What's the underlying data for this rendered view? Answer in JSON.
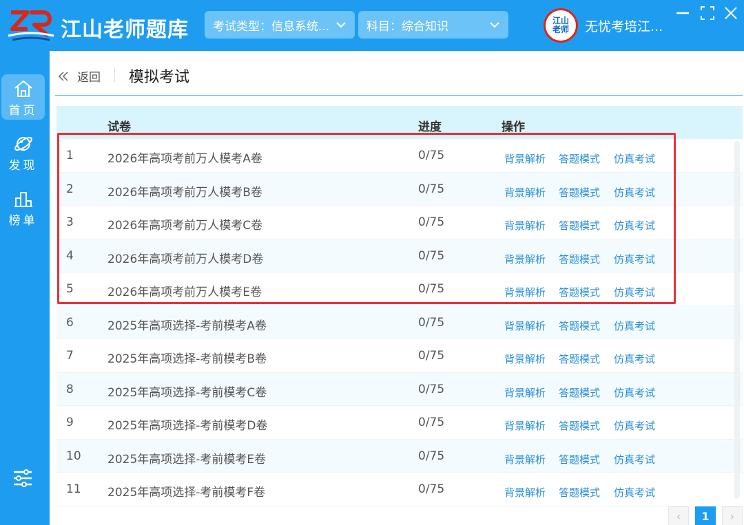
{
  "app": {
    "title": "江山老师题库",
    "logo_text": "ZR"
  },
  "header": {
    "exam_type": "考试类型：信息系统...",
    "subject": "科目：综合知识",
    "avatar_line1": "江山",
    "avatar_line2": "老师",
    "user_name": "无忧考培江..."
  },
  "sidebar": {
    "items": [
      {
        "label": "首页",
        "icon": "home-icon",
        "active": true
      },
      {
        "label": "发现",
        "icon": "planet-icon",
        "active": false
      },
      {
        "label": "榜单",
        "icon": "podium-icon",
        "active": false
      }
    ]
  },
  "main": {
    "back_label": "返回",
    "page_title": "模拟考试",
    "columns": {
      "paper": "试卷",
      "progress": "进度",
      "actions": "操作"
    },
    "action_labels": {
      "analysis": "背景解析",
      "answer": "答题模式",
      "exam": "仿真考试"
    },
    "rows": [
      {
        "idx": "1",
        "name": "2026年高项考前万人模考A卷",
        "progress": "0/75"
      },
      {
        "idx": "2",
        "name": "2026年高项考前万人模考B卷",
        "progress": "0/75"
      },
      {
        "idx": "3",
        "name": "2026年高项考前万人模考C卷",
        "progress": "0/75"
      },
      {
        "idx": "4",
        "name": "2026年高项考前万人模考D卷",
        "progress": "0/75"
      },
      {
        "idx": "5",
        "name": "2026年高项考前万人模考E卷",
        "progress": "0/75"
      },
      {
        "idx": "6",
        "name": "2025年高项选择-考前模考A卷",
        "progress": "0/75"
      },
      {
        "idx": "7",
        "name": "2025年高项选择-考前模考B卷",
        "progress": "0/75"
      },
      {
        "idx": "8",
        "name": "2025年高项选择-考前模考C卷",
        "progress": "0/75"
      },
      {
        "idx": "9",
        "name": "2025年高项选择-考前模考D卷",
        "progress": "0/75"
      },
      {
        "idx": "10",
        "name": "2025年高项选择-考前模考E卷",
        "progress": "0/75"
      },
      {
        "idx": "11",
        "name": "2025年高项选择-考前模考F卷",
        "progress": "0/75"
      }
    ]
  },
  "pagination": {
    "prev": "‹",
    "current": "1",
    "next": "›"
  },
  "colors": {
    "brand": "#1e9df0",
    "link": "#2a8fd8",
    "highlight": "#e53238",
    "header_row": "#d8f5fd"
  }
}
